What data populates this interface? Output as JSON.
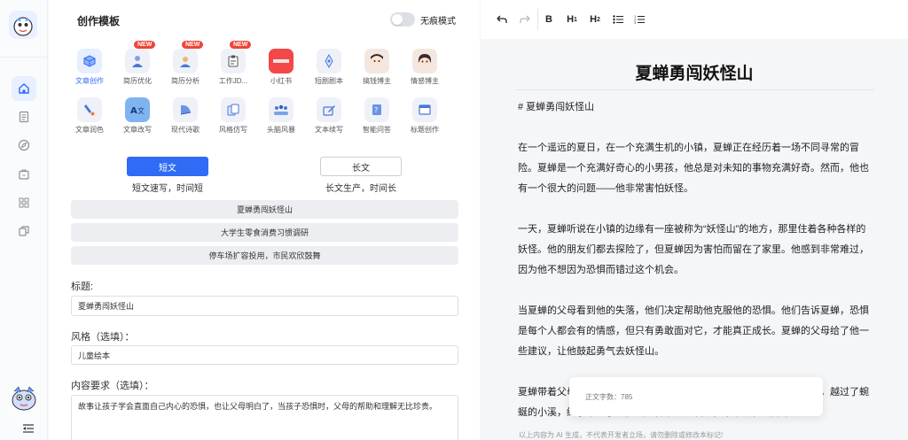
{
  "sidebar": {
    "nav": [
      "home-icon",
      "document-icon",
      "compass-icon",
      "briefcase-icon",
      "grid-icon",
      "copy-icon"
    ]
  },
  "panel": {
    "title": "创作模板",
    "incognito_label": "无痕模式",
    "tools": [
      {
        "label": "文章创作",
        "badge": "",
        "icon": "box-icon"
      },
      {
        "label": "简历优化",
        "badge": "NEW",
        "icon": "person-icon"
      },
      {
        "label": "简历分析",
        "badge": "NEW",
        "icon": "analysis-icon"
      },
      {
        "label": "工作JD...",
        "badge": "NEW",
        "icon": "clipboard-icon"
      },
      {
        "label": "小红书",
        "badge": "",
        "icon": "xiaohongshu-icon"
      },
      {
        "label": "短剧剧本",
        "badge": "",
        "icon": "pen-icon"
      },
      {
        "label": "搞钱博主",
        "badge": "",
        "icon": "avatar-icon"
      },
      {
        "label": "情感博主",
        "badge": "",
        "icon": "avatar-icon"
      },
      {
        "label": "文章润色",
        "badge": "",
        "icon": "brush-icon"
      },
      {
        "label": "文章改写",
        "badge": "",
        "icon": "translate-icon"
      },
      {
        "label": "现代诗歌",
        "badge": "",
        "icon": "fan-icon"
      },
      {
        "label": "风格仿写",
        "badge": "",
        "icon": "copy-icon"
      },
      {
        "label": "头脑风暴",
        "badge": "",
        "icon": "team-icon"
      },
      {
        "label": "文本续写",
        "badge": "",
        "icon": "edit-icon"
      },
      {
        "label": "智能问答",
        "badge": "",
        "icon": "qa-icon"
      },
      {
        "label": "标题创作",
        "badge": "",
        "icon": "window-icon"
      }
    ],
    "length": {
      "short_label": "短文",
      "short_desc": "短文速写，时间短",
      "long_label": "长文",
      "long_desc": "长文生产，时间长"
    },
    "suggestions": [
      "夏蝉勇闯妖怪山",
      "大学生零食消费习惯调研",
      "停车场扩容投用，市民欢欣鼓舞"
    ],
    "form": {
      "title_label": "标题:",
      "title_value": "夏蝉勇闯妖怪山",
      "style_label": "风格（选填）：",
      "style_value": "儿童绘本",
      "req_label": "内容要求（选填）：",
      "req_value": "故事让孩子学会直面自己内心的恐惧，也让父母明白了，当孩子恐惧时，父母的帮助和理解无比珍贵。"
    }
  },
  "editor": {
    "toolbar": {
      "undo_icon": "undo-icon",
      "redo_icon": "redo-icon",
      "bold": "B",
      "h1": "H",
      "h1_sub": "1",
      "h2": "H",
      "h2_sub": "2",
      "bullet_icon": "bullet-list-icon",
      "ordered_icon": "ordered-list-icon"
    },
    "doc_title": "夏蝉勇闯妖怪山",
    "paragraphs": [
      "# 夏蝉勇闯妖怪山",
      "在一个遥远的夏日，在一个充满生机的小镇，夏蝉正在经历着一场不同寻常的冒险。夏蝉是一个充满好奇心的小男孩，他总是对未知的事物充满好奇。然而，他也有一个很大的问题——他非常害怕妖怪。",
      "一天，夏蝉听说在小镇的边缘有一座被称为“妖怪山”的地方，那里住着各种各样的妖怪。他的朋友们都去探险了，但夏蝉因为害怕而留在了家里。他感到非常难过，因为他不想因为恐惧而错过这个机会。",
      "当夏蝉的父母看到他的失落，他们决定帮助他克服他的恐惧。他们告诉夏蝉，恐惧是每个人都会有的情感，但只有勇敢面对它，才能真正成长。夏蝉的父母给了他一些建议，让他鼓起勇气去妖怪山。",
      "夏蝉带着父母的鼓励，踏上了前往妖怪山的旅程。他穿过了茂密的森林，越过了蜿蜒的小溪，终于来到了妖怪山的脚下。他发现，原来妖怪山并不是"
    ],
    "word_count_label": "正文字数：785",
    "footer_note": "以上内容为 AI 生成，不代表开发者立场，请勿删除或修改本标记!"
  },
  "colors": {
    "accent": "#2f6bf4",
    "badge": "#f04438"
  }
}
